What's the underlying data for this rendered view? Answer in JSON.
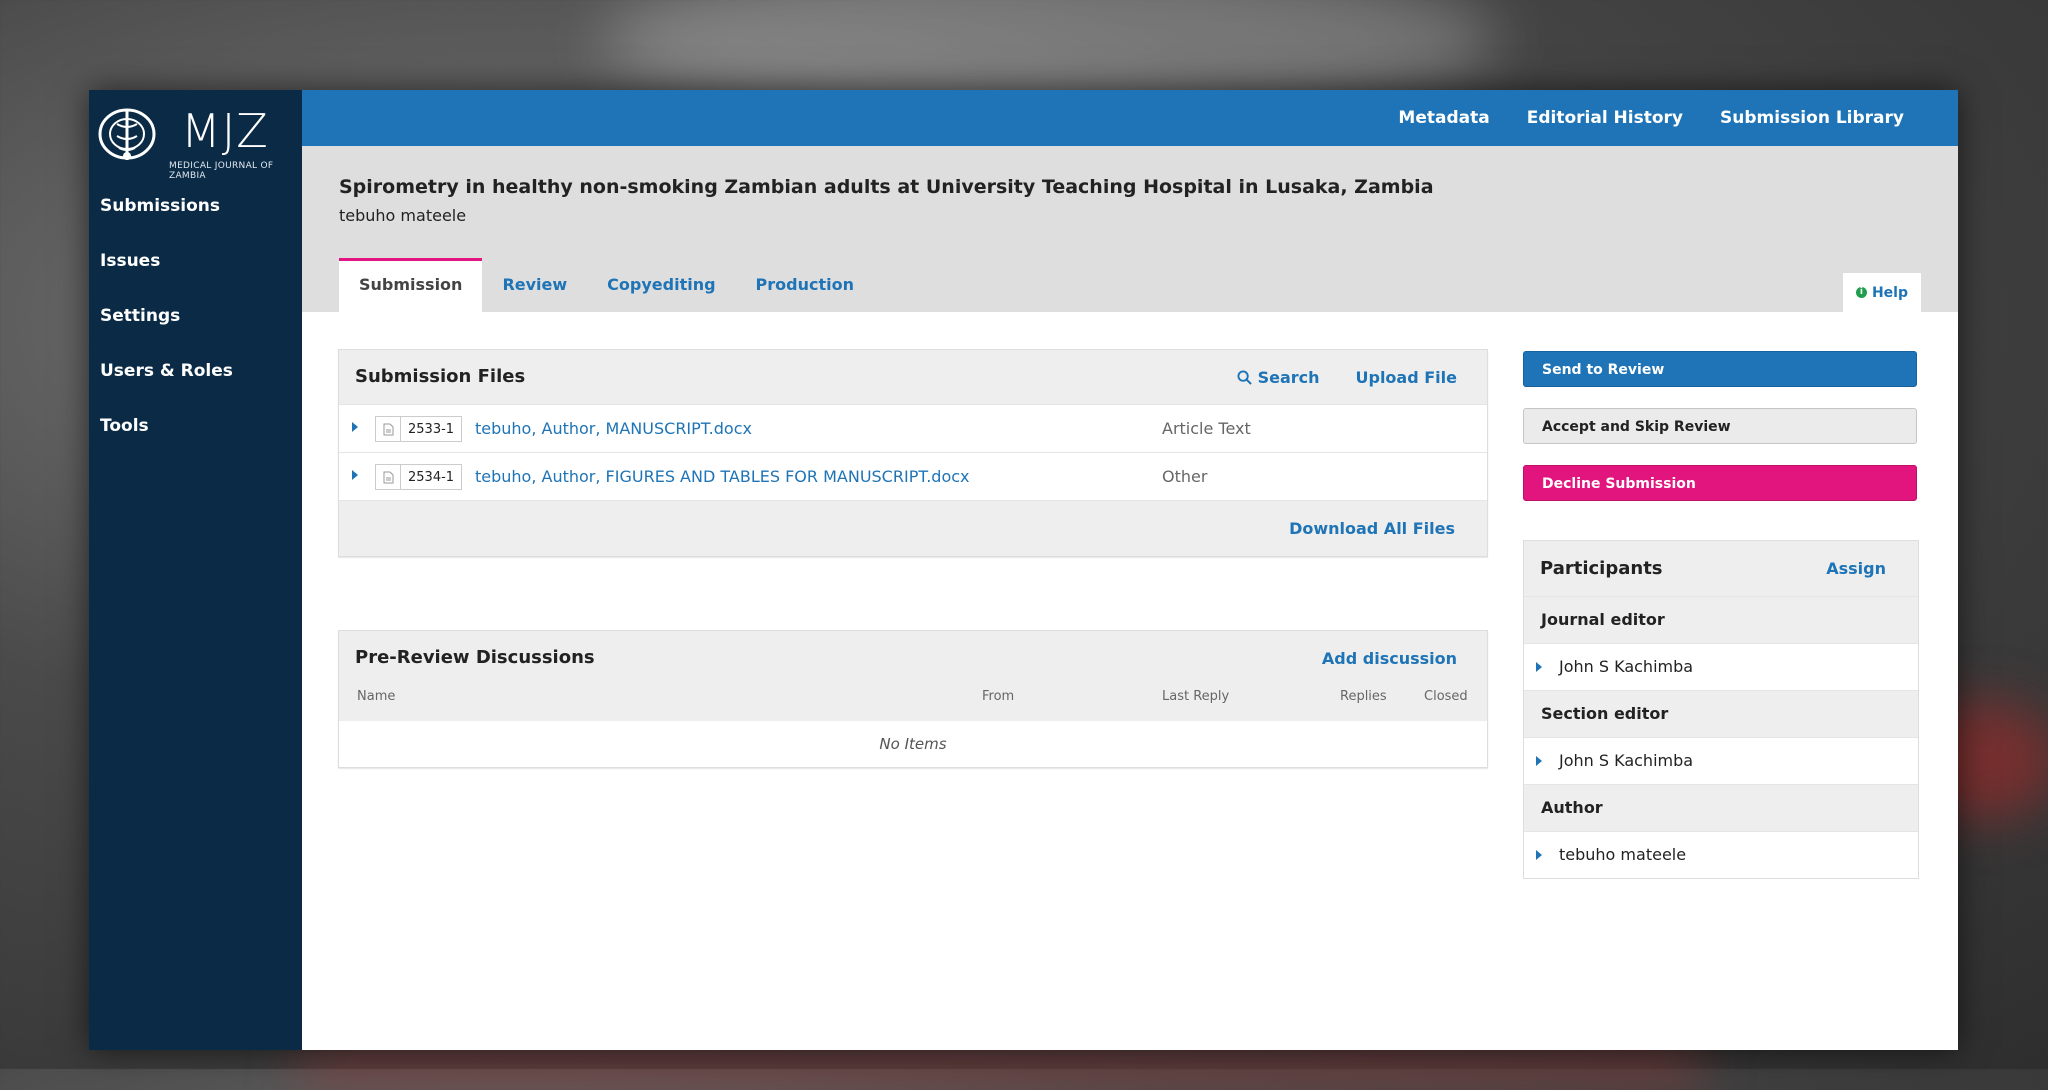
{
  "brand": {
    "name": "MJZ",
    "subtitle": "MEDICAL JOURNAL OF ZAMBIA"
  },
  "sidebar": {
    "items": [
      {
        "label": "Submissions"
      },
      {
        "label": "Issues"
      },
      {
        "label": "Settings"
      },
      {
        "label": "Users & Roles"
      },
      {
        "label": "Tools"
      }
    ]
  },
  "header": {
    "links": [
      {
        "label": "Metadata"
      },
      {
        "label": "Editorial History"
      },
      {
        "label": "Submission Library"
      }
    ]
  },
  "submission": {
    "title": "Spirometry in healthy non-smoking Zambian adults at University Teaching Hospital in Lusaka, Zambia",
    "author": "tebuho mateele"
  },
  "tabs": [
    {
      "label": "Submission",
      "active": true
    },
    {
      "label": "Review"
    },
    {
      "label": "Copyediting"
    },
    {
      "label": "Production"
    }
  ],
  "help": {
    "label": "Help"
  },
  "files_panel": {
    "title": "Submission Files",
    "search_label": "Search",
    "upload_label": "Upload File",
    "download_all_label": "Download All Files",
    "files": [
      {
        "id": "2533-1",
        "name": "tebuho, Author, MANUSCRIPT.docx",
        "type": "Article Text"
      },
      {
        "id": "2534-1",
        "name": "tebuho, Author, FIGURES AND TABLES FOR MANUSCRIPT.docx",
        "type": "Other"
      }
    ]
  },
  "discussions_panel": {
    "title": "Pre-Review Discussions",
    "add_label": "Add discussion",
    "columns": {
      "name": "Name",
      "from": "From",
      "last_reply": "Last Reply",
      "replies": "Replies",
      "closed": "Closed"
    },
    "empty_text": "No Items"
  },
  "actions": {
    "send_to_review": "Send to Review",
    "accept_skip": "Accept and Skip Review",
    "decline": "Decline Submission"
  },
  "participants": {
    "title": "Participants",
    "assign_label": "Assign",
    "groups": [
      {
        "role": "Journal editor",
        "members": [
          "John S Kachimba"
        ]
      },
      {
        "role": "Section editor",
        "members": [
          "John S Kachimba"
        ]
      },
      {
        "role": "Author",
        "members": [
          "tebuho mateele"
        ]
      }
    ]
  },
  "colors": {
    "primary": "#1e74b6",
    "sidebar": "#0a2a45",
    "danger": "#e2157f",
    "tab_active_border": "#e31582"
  }
}
